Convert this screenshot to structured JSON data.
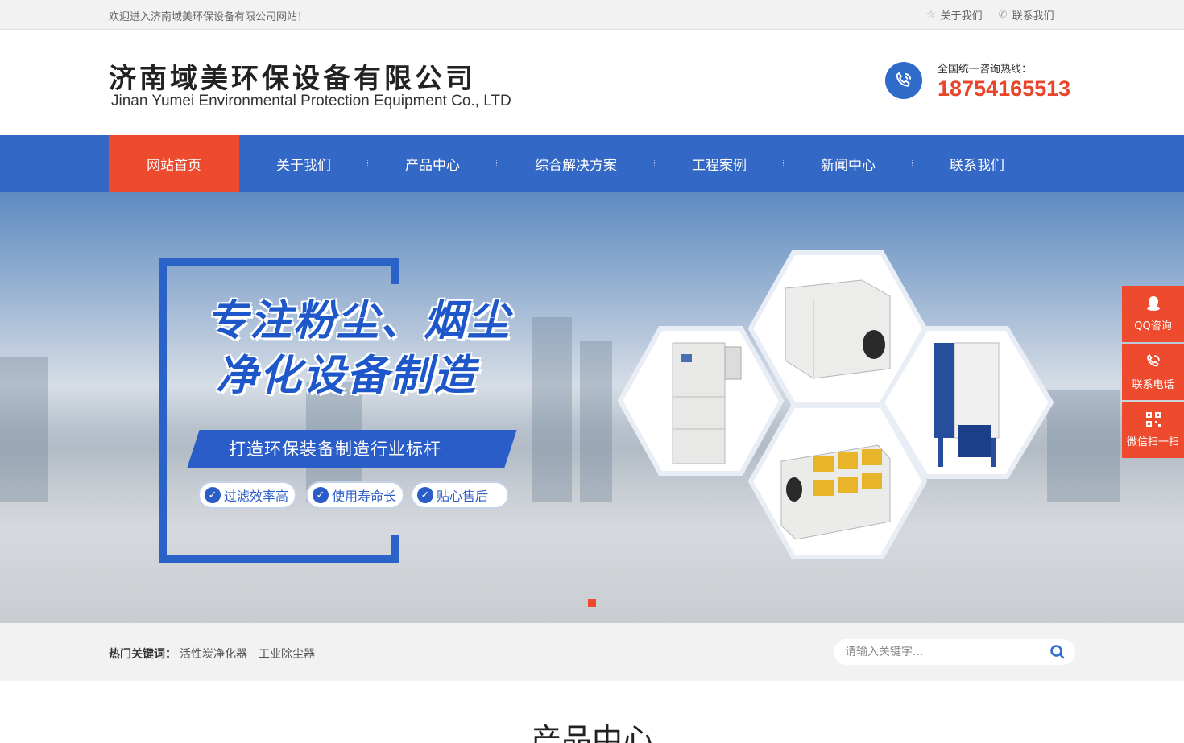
{
  "topbar": {
    "welcome": "欢迎进入济南域美环保设备有限公司网站！",
    "links": [
      {
        "icon": "star-icon",
        "label": "关于我们"
      },
      {
        "icon": "phone-icon",
        "label": "联系我们"
      }
    ]
  },
  "header": {
    "company_cn": "济南域美环保设备有限公司",
    "company_en": "Jinan Yumei Environmental Protection Equipment Co., LTD",
    "hotline_label": "全国统一咨询热线：",
    "hotline_number": "18754165513"
  },
  "nav": {
    "items": [
      {
        "label": "网站首页",
        "active": true
      },
      {
        "label": "关于我们"
      },
      {
        "label": "产品中心"
      },
      {
        "label": "综合解决方案"
      },
      {
        "label": "工程案例"
      },
      {
        "label": "新闻中心"
      },
      {
        "label": "联系我们"
      }
    ]
  },
  "banner": {
    "slogan_line1": "专注粉尘、烟尘",
    "slogan_line2": "净化设备制造",
    "ribbon": "打造环保装备制造行业标杆",
    "features": [
      "过滤效率高",
      "使用寿命长",
      "贴心售后"
    ],
    "slide_count": 1,
    "active_slide": 0
  },
  "keywords": {
    "label": "热门关键词：",
    "items": [
      "活性炭净化器",
      "工业除尘器"
    ]
  },
  "search": {
    "placeholder": "请输入关键字..."
  },
  "section": {
    "title": "产品中心"
  },
  "sidebar": {
    "items": [
      {
        "icon": "qq-icon",
        "label": "QQ咨询"
      },
      {
        "icon": "phone-icon",
        "label": "联系电话"
      },
      {
        "icon": "qrcode-icon",
        "label": "微信扫一扫"
      }
    ]
  },
  "colors": {
    "nav_blue": "#3368c6",
    "accent_red": "#ee4a2d",
    "hotline_red": "#e8462b"
  }
}
